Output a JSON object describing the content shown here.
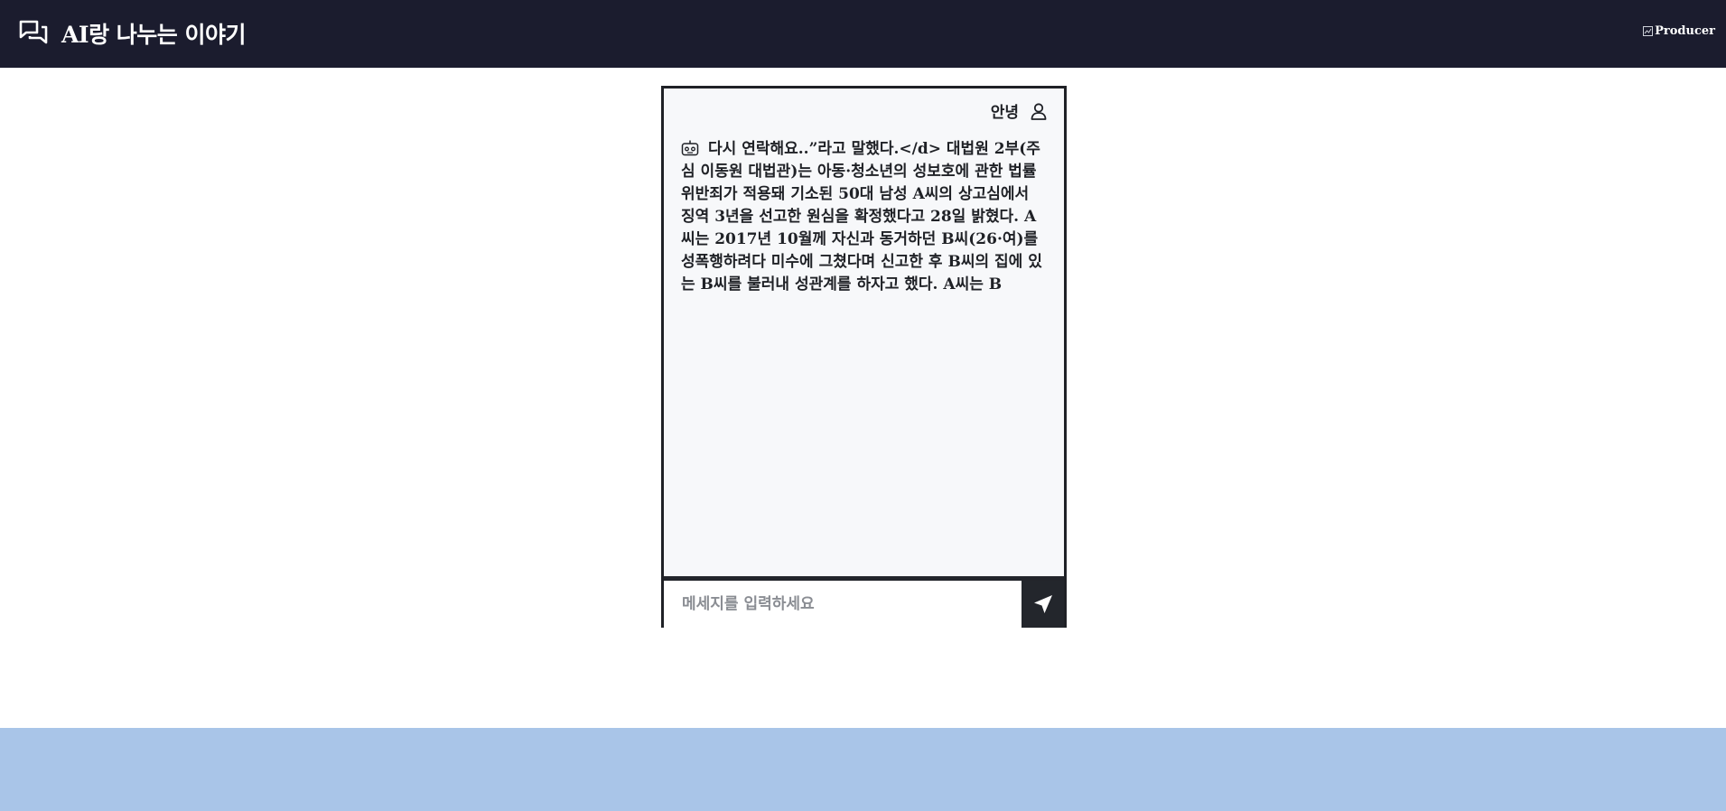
{
  "header": {
    "title": "AI랑 나누는 이야기",
    "logo_icon": "chat-bubbles-icon",
    "producer_label": "Producer",
    "producer_icon": "broken-image-icon",
    "background": "#1b1c2e"
  },
  "chat": {
    "user_name": "안녕",
    "user_icon": "user-icon",
    "bot_icon": "robot-icon",
    "message": "다시 연락해요..”라고 말했다.</d> 대법원 2부(주심 이동원 대법관)는 아동·청소년의 성보호에 관한 법률위반죄가 적용돼 기소된 50대 남성 A씨의 상고심에서 징역 3년을 선고한 원심을 확정했다고 28일 밝혔다. A씨는 2017년 10월께 자신과 동거하던 B씨(26·여)를 성폭행하려다 미수에 그쳤다며 신고한 후 B씨의 집에 있는 B씨를 불러내 성관계를 하자고 했다. A씨는 B",
    "input_placeholder": "메세지를 입력하세요",
    "input_value": "",
    "send_icon": "send-icon"
  },
  "colors": {
    "footer_band": "#a9c5e8",
    "panel": "#f7f8fa",
    "send_button": "#23262c"
  }
}
